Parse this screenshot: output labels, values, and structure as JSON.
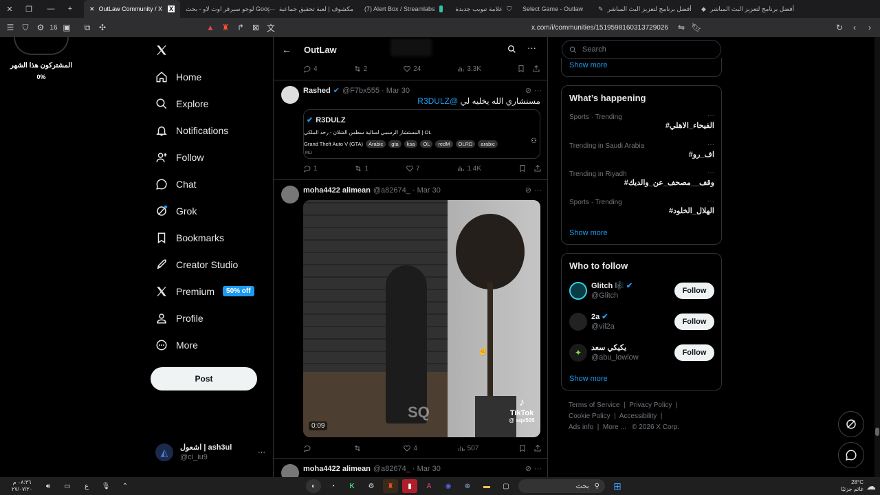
{
  "browser": {
    "tabs": [
      {
        "label": "OutLaw Community / X",
        "active": true
      },
      {
        "label": "لوجو سيرفر اوت لاو - بحث Google",
        "active": false
      },
      {
        "label": "مكشوف | لعبة تحقيق جماعية",
        "active": false
      },
      {
        "label": "(7) Alert Box / Streamlabs",
        "active": false
      },
      {
        "label": "علامة تبويب جديدة",
        "active": false
      },
      {
        "label": "Select Game - Outlaw",
        "active": false
      },
      {
        "label": "أفضل برنامج لتعزيز البث المباشر",
        "active": false
      },
      {
        "label": "أفضل برنامج لتعزيز البث المباشر",
        "active": false
      }
    ],
    "address": "x.com/i/communities/1519598160313729026",
    "counter": "16"
  },
  "overlay": {
    "title": "المشتركون هذا الشهر",
    "percent": "0%"
  },
  "nav": {
    "items": [
      {
        "label": "Home",
        "icon": "home-icon"
      },
      {
        "label": "Explore",
        "icon": "search-icon"
      },
      {
        "label": "Notifications",
        "icon": "bell-icon"
      },
      {
        "label": "Follow",
        "icon": "person-add-icon"
      },
      {
        "label": "Chat",
        "icon": "chat-icon"
      },
      {
        "label": "Grok",
        "icon": "grok-icon"
      },
      {
        "label": "Bookmarks",
        "icon": "bookmark-icon"
      },
      {
        "label": "Creator Studio",
        "icon": "rocket-icon"
      },
      {
        "label": "Premium",
        "icon": "x-logo-icon",
        "badge": "50% off"
      },
      {
        "label": "Profile",
        "icon": "person-icon"
      },
      {
        "label": "More",
        "icon": "more-circle-icon"
      }
    ],
    "post_label": "Post",
    "account": {
      "name": "اشعول | ash3ul",
      "handle": "@ci_iu9"
    }
  },
  "main": {
    "header_title": "OutLaw",
    "top_actions": {
      "replies": "4",
      "reposts": "2",
      "likes": "24",
      "views": "3.3K"
    },
    "tweet1": {
      "name": "Rashed",
      "meta": "@F7bx555 · Mar 30",
      "text": "مستشاري الله يخليه لي",
      "mention": "@R3DULZ",
      "card_name": "R3DULZ",
      "card_bio": "المستشار الرسمي لسالية سطس الشلان - رحد الملكي | OL",
      "card_game": "Grand Theft Auto V (GTA)",
      "card_tags": [
        "Arabic",
        "gta",
        "ksa",
        "OL",
        "redM",
        "OLRD",
        "arabic"
      ],
      "card_extra": "MLI",
      "actions": {
        "replies": "1",
        "reposts": "1",
        "likes": "7",
        "views": "1.4K"
      }
    },
    "tweet2": {
      "name": "moha4422 alimean",
      "meta": "@a82674_ · Mar 30",
      "video_time": "0:09",
      "watermark": "SQ",
      "tiktok_label": "TikTok",
      "tiktok_handle": "@ sqx505",
      "actions": {
        "replies": "",
        "reposts": "",
        "likes": "4",
        "views": "507"
      }
    },
    "tweet3": {
      "name": "moha4422 alimean",
      "meta": "@a82674_ · Mar 30"
    }
  },
  "right": {
    "search_placeholder": "Search",
    "show_more_top": "Show more",
    "happening_title": "What’s happening",
    "trends": [
      {
        "category": "Sports · Trending",
        "tag": "#الفيحاء_الاهلي"
      },
      {
        "category": "Trending in Saudi Arabia",
        "tag": "#اف_رو"
      },
      {
        "category": "Trending in Riyadh",
        "tag": "#وقف__مصحف_عن_والديك"
      },
      {
        "category": "Sports · Trending",
        "tag": "#الهلال_الخلود"
      }
    ],
    "show_more_trends": "Show more",
    "wtf_title": "Who to follow",
    "who_to_follow": [
      {
        "name": "Glitch 🎼",
        "handle": "@Glitch",
        "button": "Follow"
      },
      {
        "name": "2a",
        "handle": "@vil2a",
        "button": "Follow"
      },
      {
        "name": "يكيكي سعد",
        "handle": "@abu_lowlow",
        "button": "Follow"
      }
    ],
    "show_more_wtf": "Show more",
    "footer": [
      "Terms of Service",
      "Privacy Policy",
      "Cookie Policy",
      "Accessibility",
      "Ads info",
      "More ...",
      "© 2026 X Corp."
    ]
  },
  "taskbar": {
    "time": "٠٨:٣٦ م",
    "date": "٢٧/٠٧/٢٠",
    "lang": "ع",
    "search_label": "بحث",
    "temp": "28°C",
    "weather": "غائم جزئيًا"
  }
}
